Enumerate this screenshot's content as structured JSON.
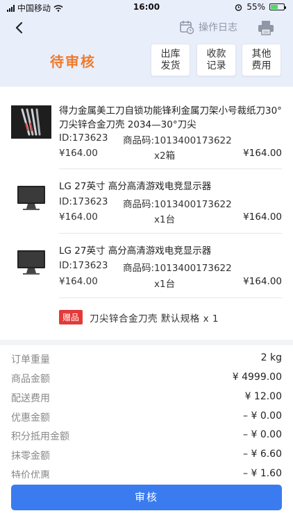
{
  "status_bar": {
    "carrier": "中国移动",
    "time": "16:00",
    "battery_percent": "55%",
    "battery_level": 0.55
  },
  "header": {
    "operation_log": "操作日志",
    "status_title": "待审核",
    "buttons": [
      {
        "line1": "出库",
        "line2": "发货"
      },
      {
        "line1": "收款",
        "line2": "记录"
      },
      {
        "line1": "其他",
        "line2": "费用"
      }
    ]
  },
  "items": [
    {
      "name": "得力金属美工刀自锁功能锋利金属刀架小号裁纸刀30°刀尖锌合金刀壳 2034—30°刀尖",
      "id": "ID:173623",
      "code": "商品码:1013400173622",
      "price": "¥164.00",
      "qty": "x2箱",
      "amount": "¥164.00",
      "thumb_icon": "knife-set-icon"
    },
    {
      "name": "LG 27英寸 高分高清游戏电竞显示器",
      "id": "ID:173623",
      "code": "商品码:1013400173622",
      "price": "¥164.00",
      "qty": "x1台",
      "amount": "¥164.00",
      "thumb_icon": "monitor-icon"
    },
    {
      "name": "LG 27英寸 高分高清游戏电竞显示器",
      "id": "ID:173623",
      "code": "商品码:1013400173622",
      "price": "¥164.00",
      "qty": "x1台",
      "amount": "¥164.00",
      "thumb_icon": "monitor-icon"
    }
  ],
  "gift": {
    "badge": "赠品",
    "text": "刀尖锌合金刀壳  默认规格 x 1"
  },
  "summary": [
    {
      "label": "订单重量",
      "value": "2 kg"
    },
    {
      "label": "商品金额",
      "value": "¥ 4999.00"
    },
    {
      "label": "配送费用",
      "value": "¥ 12.00"
    },
    {
      "label": "优惠金额",
      "value": "– ¥ 0.00"
    },
    {
      "label": "积分抵用金额",
      "value": "– ¥ 0.00"
    },
    {
      "label": "抹零金额",
      "value": "– ¥ 6.60"
    },
    {
      "label": "特价优惠",
      "value": "– ¥ 1.60"
    }
  ],
  "footer": {
    "submit_label": "审核"
  },
  "colors": {
    "accent": "#3a7bf0",
    "title_orange": "#f07a2a",
    "gift_red": "#e23a3a",
    "header_bg": "#e9eefb"
  }
}
